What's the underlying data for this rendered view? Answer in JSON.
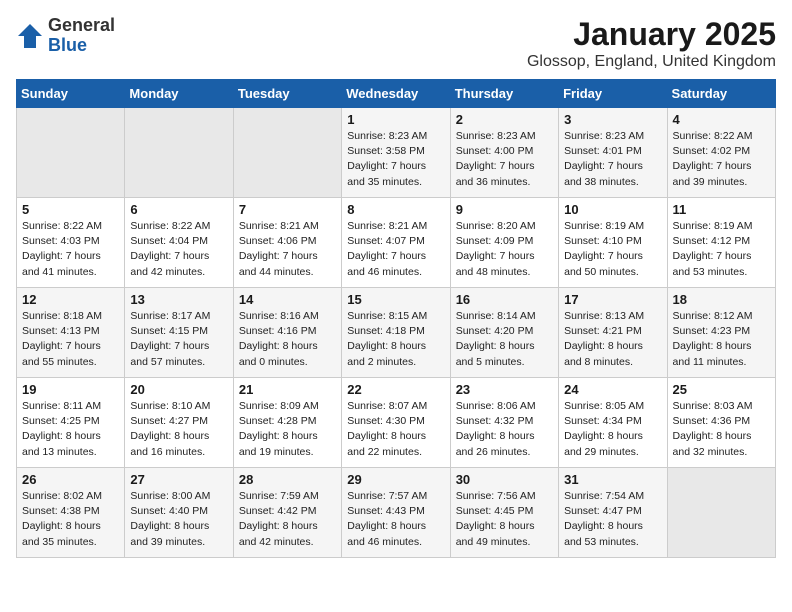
{
  "logo": {
    "general": "General",
    "blue": "Blue"
  },
  "title": "January 2025",
  "subtitle": "Glossop, England, United Kingdom",
  "weekdays": [
    "Sunday",
    "Monday",
    "Tuesday",
    "Wednesday",
    "Thursday",
    "Friday",
    "Saturday"
  ],
  "weeks": [
    [
      {
        "day": "",
        "info": ""
      },
      {
        "day": "",
        "info": ""
      },
      {
        "day": "",
        "info": ""
      },
      {
        "day": "1",
        "info": "Sunrise: 8:23 AM\nSunset: 3:58 PM\nDaylight: 7 hours and 35 minutes."
      },
      {
        "day": "2",
        "info": "Sunrise: 8:23 AM\nSunset: 4:00 PM\nDaylight: 7 hours and 36 minutes."
      },
      {
        "day": "3",
        "info": "Sunrise: 8:23 AM\nSunset: 4:01 PM\nDaylight: 7 hours and 38 minutes."
      },
      {
        "day": "4",
        "info": "Sunrise: 8:22 AM\nSunset: 4:02 PM\nDaylight: 7 hours and 39 minutes."
      }
    ],
    [
      {
        "day": "5",
        "info": "Sunrise: 8:22 AM\nSunset: 4:03 PM\nDaylight: 7 hours and 41 minutes."
      },
      {
        "day": "6",
        "info": "Sunrise: 8:22 AM\nSunset: 4:04 PM\nDaylight: 7 hours and 42 minutes."
      },
      {
        "day": "7",
        "info": "Sunrise: 8:21 AM\nSunset: 4:06 PM\nDaylight: 7 hours and 44 minutes."
      },
      {
        "day": "8",
        "info": "Sunrise: 8:21 AM\nSunset: 4:07 PM\nDaylight: 7 hours and 46 minutes."
      },
      {
        "day": "9",
        "info": "Sunrise: 8:20 AM\nSunset: 4:09 PM\nDaylight: 7 hours and 48 minutes."
      },
      {
        "day": "10",
        "info": "Sunrise: 8:19 AM\nSunset: 4:10 PM\nDaylight: 7 hours and 50 minutes."
      },
      {
        "day": "11",
        "info": "Sunrise: 8:19 AM\nSunset: 4:12 PM\nDaylight: 7 hours and 53 minutes."
      }
    ],
    [
      {
        "day": "12",
        "info": "Sunrise: 8:18 AM\nSunset: 4:13 PM\nDaylight: 7 hours and 55 minutes."
      },
      {
        "day": "13",
        "info": "Sunrise: 8:17 AM\nSunset: 4:15 PM\nDaylight: 7 hours and 57 minutes."
      },
      {
        "day": "14",
        "info": "Sunrise: 8:16 AM\nSunset: 4:16 PM\nDaylight: 8 hours and 0 minutes."
      },
      {
        "day": "15",
        "info": "Sunrise: 8:15 AM\nSunset: 4:18 PM\nDaylight: 8 hours and 2 minutes."
      },
      {
        "day": "16",
        "info": "Sunrise: 8:14 AM\nSunset: 4:20 PM\nDaylight: 8 hours and 5 minutes."
      },
      {
        "day": "17",
        "info": "Sunrise: 8:13 AM\nSunset: 4:21 PM\nDaylight: 8 hours and 8 minutes."
      },
      {
        "day": "18",
        "info": "Sunrise: 8:12 AM\nSunset: 4:23 PM\nDaylight: 8 hours and 11 minutes."
      }
    ],
    [
      {
        "day": "19",
        "info": "Sunrise: 8:11 AM\nSunset: 4:25 PM\nDaylight: 8 hours and 13 minutes."
      },
      {
        "day": "20",
        "info": "Sunrise: 8:10 AM\nSunset: 4:27 PM\nDaylight: 8 hours and 16 minutes."
      },
      {
        "day": "21",
        "info": "Sunrise: 8:09 AM\nSunset: 4:28 PM\nDaylight: 8 hours and 19 minutes."
      },
      {
        "day": "22",
        "info": "Sunrise: 8:07 AM\nSunset: 4:30 PM\nDaylight: 8 hours and 22 minutes."
      },
      {
        "day": "23",
        "info": "Sunrise: 8:06 AM\nSunset: 4:32 PM\nDaylight: 8 hours and 26 minutes."
      },
      {
        "day": "24",
        "info": "Sunrise: 8:05 AM\nSunset: 4:34 PM\nDaylight: 8 hours and 29 minutes."
      },
      {
        "day": "25",
        "info": "Sunrise: 8:03 AM\nSunset: 4:36 PM\nDaylight: 8 hours and 32 minutes."
      }
    ],
    [
      {
        "day": "26",
        "info": "Sunrise: 8:02 AM\nSunset: 4:38 PM\nDaylight: 8 hours and 35 minutes."
      },
      {
        "day": "27",
        "info": "Sunrise: 8:00 AM\nSunset: 4:40 PM\nDaylight: 8 hours and 39 minutes."
      },
      {
        "day": "28",
        "info": "Sunrise: 7:59 AM\nSunset: 4:42 PM\nDaylight: 8 hours and 42 minutes."
      },
      {
        "day": "29",
        "info": "Sunrise: 7:57 AM\nSunset: 4:43 PM\nDaylight: 8 hours and 46 minutes."
      },
      {
        "day": "30",
        "info": "Sunrise: 7:56 AM\nSunset: 4:45 PM\nDaylight: 8 hours and 49 minutes."
      },
      {
        "day": "31",
        "info": "Sunrise: 7:54 AM\nSunset: 4:47 PM\nDaylight: 8 hours and 53 minutes."
      },
      {
        "day": "",
        "info": ""
      }
    ]
  ]
}
